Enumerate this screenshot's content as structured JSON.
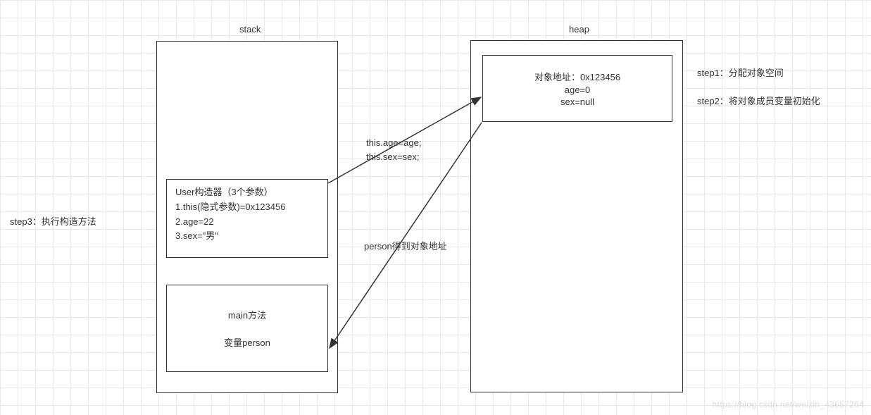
{
  "stack": {
    "title": "stack",
    "constructor_box": {
      "line1": "User构造器（3个参数）",
      "line2": "1.this(隐式参数)=0x123456",
      "line3": "2.age=22",
      "line4": "3.sex=\"男\""
    },
    "main_box": {
      "line1": "main方法",
      "line2": "变量person"
    }
  },
  "heap": {
    "title": "heap",
    "object_box": {
      "line1": "对象地址：0x123456",
      "line2": "age=0",
      "line3": "sex=null"
    }
  },
  "steps": {
    "step1": "step1：分配对象空间",
    "step2": "step2：将对象成员变量初始化",
    "step3": "step3：执行构造方法"
  },
  "arrow_labels": {
    "assign": "this.age=age;\nthis.sex=sex;",
    "person_addr": "person得到对象地址"
  },
  "watermark": "https://blog.csdn.net/weixin_43657264"
}
